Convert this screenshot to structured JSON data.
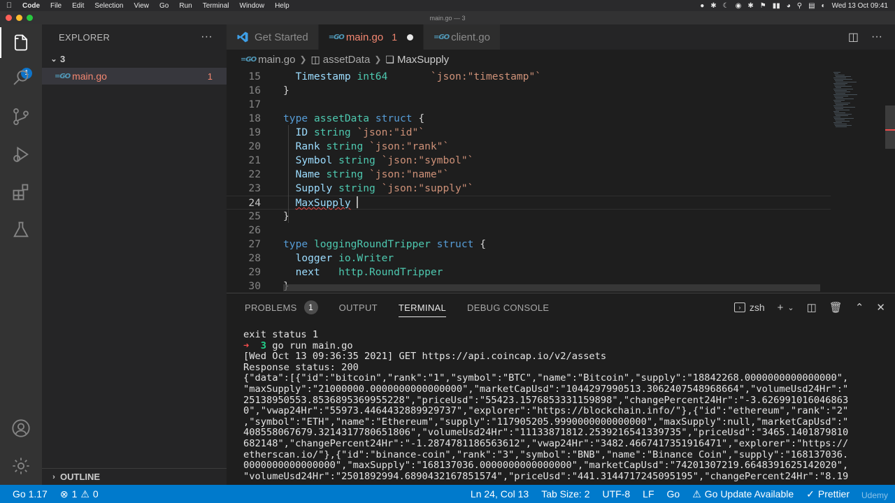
{
  "menubar": {
    "app_name": "Code",
    "items": [
      "File",
      "Edit",
      "Selection",
      "View",
      "Go",
      "Run",
      "Terminal",
      "Window",
      "Help"
    ],
    "datetime": "Wed 13 Oct  09:41"
  },
  "window": {
    "title": "main.go — 3"
  },
  "activity": {
    "explorer_badge": "1"
  },
  "sidebar": {
    "title": "EXPLORER",
    "folder": "3",
    "file": {
      "name": "main.go",
      "problems": "1"
    },
    "outline_label": "OUTLINE"
  },
  "tabs": [
    {
      "label": "Get Started"
    },
    {
      "label": "main.go",
      "problems": "1"
    },
    {
      "label": "client.go"
    }
  ],
  "breadcrumb": {
    "file": "main.go",
    "struct": "assetData",
    "field": "MaxSupply"
  },
  "editor": {
    "lines": [
      {
        "n": "15",
        "tokens": [
          [
            "id",
            "  Timestamp "
          ],
          [
            "ty",
            "int64"
          ],
          [
            "pl",
            "       "
          ],
          [
            "st",
            "`json:\"timestamp\"`"
          ]
        ]
      },
      {
        "n": "16",
        "tokens": [
          [
            "pl",
            "}"
          ]
        ]
      },
      {
        "n": "17",
        "tokens": []
      },
      {
        "n": "18",
        "tokens": [
          [
            "kw",
            "type "
          ],
          [
            "ty",
            "assetData "
          ],
          [
            "kw",
            "struct "
          ],
          [
            "pl",
            "{"
          ]
        ]
      },
      {
        "n": "19",
        "tokens": [
          [
            "id",
            "  ID "
          ],
          [
            "ty",
            "string "
          ],
          [
            "st",
            "`json:\"id\"`"
          ]
        ]
      },
      {
        "n": "20",
        "tokens": [
          [
            "id",
            "  Rank "
          ],
          [
            "ty",
            "string "
          ],
          [
            "st",
            "`json:\"rank\"`"
          ]
        ]
      },
      {
        "n": "21",
        "tokens": [
          [
            "id",
            "  Symbol "
          ],
          [
            "ty",
            "string "
          ],
          [
            "st",
            "`json:\"symbol\"`"
          ]
        ]
      },
      {
        "n": "22",
        "tokens": [
          [
            "id",
            "  Name "
          ],
          [
            "ty",
            "string "
          ],
          [
            "st",
            "`json:\"name\"`"
          ]
        ]
      },
      {
        "n": "23",
        "tokens": [
          [
            "id",
            "  Supply "
          ],
          [
            "ty",
            "string "
          ],
          [
            "st",
            "`json:\"supply\"`"
          ]
        ]
      },
      {
        "n": "24",
        "tokens": [
          [
            "pl",
            "  "
          ],
          [
            "err",
            "MaxSupply"
          ],
          [
            "pl",
            " "
          ],
          [
            "caret",
            ""
          ]
        ],
        "current": true
      },
      {
        "n": "25",
        "tokens": [
          [
            "pl",
            "}"
          ]
        ]
      },
      {
        "n": "26",
        "tokens": []
      },
      {
        "n": "27",
        "tokens": [
          [
            "kw",
            "type "
          ],
          [
            "ty",
            "loggingRoundTripper "
          ],
          [
            "kw",
            "struct "
          ],
          [
            "pl",
            "{"
          ]
        ]
      },
      {
        "n": "28",
        "tokens": [
          [
            "id",
            "  logger "
          ],
          [
            "ty",
            "io.Writer"
          ]
        ]
      },
      {
        "n": "29",
        "tokens": [
          [
            "id",
            "  next   "
          ],
          [
            "ty",
            "http.RoundTripper"
          ]
        ]
      },
      {
        "n": "30",
        "tokens": [
          [
            "pl",
            "}"
          ]
        ]
      }
    ]
  },
  "panel": {
    "tabs": [
      {
        "label": "PROBLEMS",
        "badge": "1"
      },
      {
        "label": "OUTPUT"
      },
      {
        "label": "TERMINAL",
        "active": true
      },
      {
        "label": "DEBUG CONSOLE"
      }
    ],
    "shell": "zsh",
    "terminal_lines": [
      "exit status 1",
      "__PROMPT__",
      "[Wed Oct 13 09:36:35 2021] GET https://api.coincap.io/v2/assets",
      "Response status: 200",
      "{\"data\":[{\"id\":\"bitcoin\",\"rank\":\"1\",\"symbol\":\"BTC\",\"name\":\"Bitcoin\",\"supply\":\"18842268.0000000000000000\",",
      "\"maxSupply\":\"21000000.0000000000000000\",\"marketCapUsd\":\"1044297990513.3062407548968664\",\"volumeUsd24Hr\":\"",
      "25138950553.8536895369955228\",\"priceUsd\":\"55423.1576853331159898\",\"changePercent24Hr\":\"-3.626991016046863",
      "0\",\"vwap24Hr\":\"55973.4464432889929737\",\"explorer\":\"https://blockchain.info/\"},{\"id\":\"ethereum\",\"rank\":\"2\"",
      ",\"symbol\":\"ETH\",\"name\":\"Ethereum\",\"supply\":\"117905205.9990000000000000\",\"maxSupply\":null,\"marketCapUsd\":\"",
      "408558067679.3214317780651806\",\"volumeUsd24Hr\":\"11133871812.2539216541339735\",\"priceUsd\":\"3465.1401879810",
      "682148\",\"changePercent24Hr\":\"-1.2874781186563612\",\"vwap24Hr\":\"3482.4667417351916471\",\"explorer\":\"https://",
      "etherscan.io/\"},{\"id\":\"binance-coin\",\"rank\":\"3\",\"symbol\":\"BNB\",\"name\":\"Binance Coin\",\"supply\":\"168137036.",
      "0000000000000000\",\"maxSupply\":\"168137036.0000000000000000\",\"marketCapUsd\":\"74201307219.6648391625142020\",",
      "\"volumeUsd24Hr\":\"2501892994.6890432167851574\",\"priceUsd\":\"441.3144717245095195\",\"changePercent24Hr\":\"8.19"
    ],
    "prompt": {
      "arrow": "➜",
      "dir": "3",
      "command": "go run main.go"
    }
  },
  "statusbar": {
    "go_version": "Go 1.17",
    "errors": "1",
    "warnings": "0",
    "position": "Ln 24, Col 13",
    "tab_size": "Tab Size: 2",
    "encoding": "UTF-8",
    "eol": "LF",
    "language": "Go",
    "go_update": "Go Update Available",
    "prettier": "Prettier",
    "watermark": "Udemy"
  },
  "colors": {
    "accent": "#007acc",
    "error": "#f48771"
  }
}
